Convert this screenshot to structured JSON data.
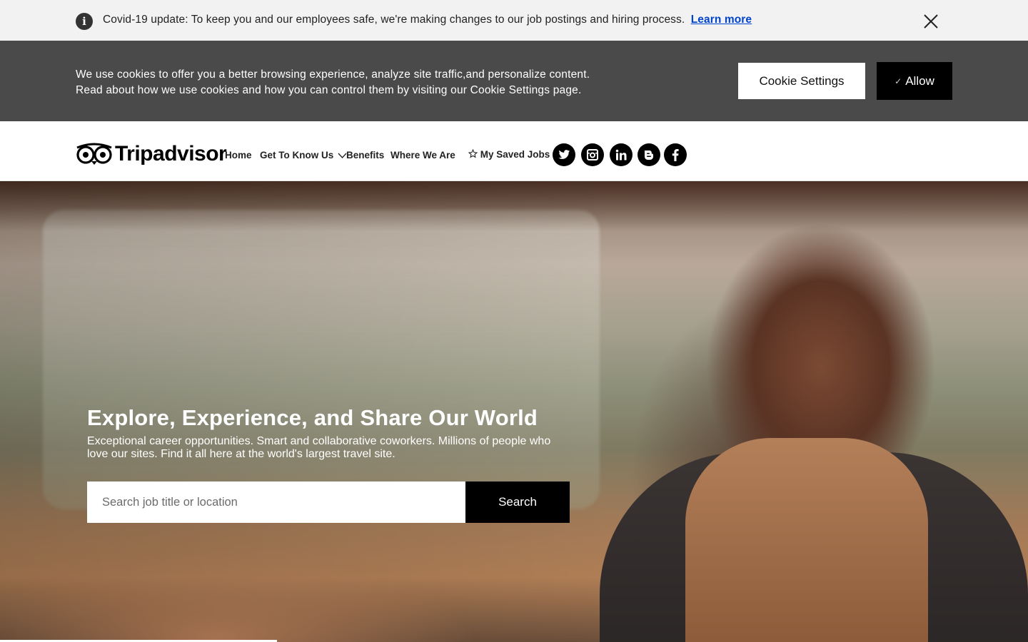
{
  "covid": {
    "text": "Covid-19 update: To keep you and our employees safe, we're making changes to our job postings and hiring process.",
    "link": "Learn more"
  },
  "cookie": {
    "line1": "We use cookies to offer you a better browsing experience, analyze site traffic,and personalize content.",
    "line2": "Read about how we use cookies and how you can control them by visiting our Cookie Settings page.",
    "settings_label": "Cookie Settings",
    "allow_label": "Allow",
    "allow_icon": "checkmark-icon"
  },
  "nav": {
    "logo": "Tripadvisor",
    "items": [
      "Home",
      "Get To Know Us",
      "Benefits",
      "Where We Are"
    ],
    "saved_jobs": "My Saved Jobs",
    "social": [
      "twitter-icon",
      "instagram-icon",
      "linkedin-icon",
      "blogger-icon",
      "facebook-icon"
    ]
  },
  "hero": {
    "title": "Explore, Experience, and Share Our World",
    "subtitle": "Exceptional career opportunities. Smart and collaborative coworkers. Millions of people who love our sites. Find it all here at the world's largest travel site.",
    "search_placeholder": "Search job title or location",
    "search_button": "Search"
  },
  "colors": {
    "covid_bg": "#f2f2f2",
    "cookie_bg": "#4a4a4a",
    "link": "#0044cc",
    "button_dark": "#000000"
  }
}
